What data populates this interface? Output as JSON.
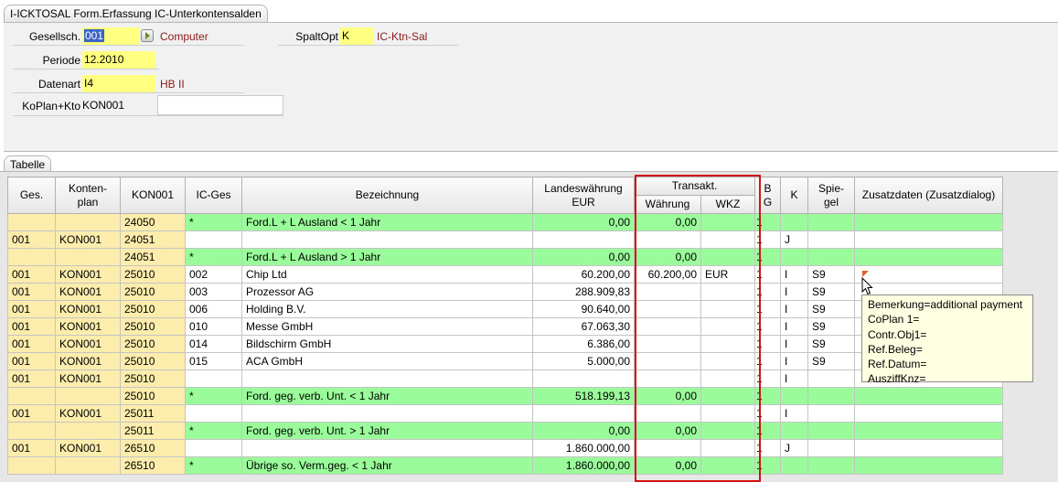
{
  "window": {
    "title": "I-ICKTOSAL Form.Erfassung IC-Unterkontensalden"
  },
  "form": {
    "gesellsch": {
      "label": "Gesellsch.",
      "value": "001",
      "desc": "Computer"
    },
    "periode": {
      "label": "Periode",
      "value": "12.2010"
    },
    "datenart": {
      "label": "Datenart",
      "value": "I4",
      "desc": "HB II"
    },
    "koplan": {
      "label": "KoPlan+Kto",
      "value": "KON001",
      "input_value": ""
    },
    "spaltopt": {
      "label": "SpaltOpt",
      "value": "K",
      "desc": "IC-Ktn-Sal"
    }
  },
  "table": {
    "tab_label": "Tabelle",
    "headers": {
      "ges": "Ges.",
      "konten_1": "Konten-",
      "konten_2": "plan",
      "kon": "KON001",
      "icges": "IC-Ges",
      "bez": "Bezeichnung",
      "lw_1": "Landeswährung",
      "lw_2": "EUR",
      "transakt": "Transakt.",
      "waehrung": "Währung",
      "wkz": "WKZ",
      "bg_1": "B",
      "bg_2": "G",
      "k": "K",
      "spiegel_1": "Spie-",
      "spiegel_2": "gel",
      "zusatz": "Zusatzdaten (Zusatzdialog)"
    },
    "rows": [
      {
        "type": "g",
        "ges": "",
        "plan": "",
        "kto": "24050",
        "icges": "*",
        "bez": "Ford.L + L Ausland < 1 Jahr",
        "lw": "0,00",
        "waehrung": "0,00",
        "wkz": "",
        "bg": "1",
        "k": "",
        "spiegel": "",
        "zusatz": ""
      },
      {
        "type": "w",
        "ges": "001",
        "plan": "KON001",
        "kto": "24051",
        "icges": "",
        "bez": "",
        "lw": "",
        "waehrung": "",
        "wkz": "",
        "bg": "1",
        "k": "J",
        "spiegel": "",
        "zusatz": ""
      },
      {
        "type": "g",
        "ges": "",
        "plan": "",
        "kto": "24051",
        "icges": "*",
        "bez": "Ford.L + L Ausland > 1 Jahr",
        "lw": "0,00",
        "waehrung": "0,00",
        "wkz": "",
        "bg": "1",
        "k": "",
        "spiegel": "",
        "zusatz": ""
      },
      {
        "type": "w",
        "ges": "001",
        "plan": "KON001",
        "kto": "25010",
        "icges": "002",
        "bez": "Chip Ltd",
        "lw": "60.200,00",
        "waehrung": "60.200,00",
        "wkz": "EUR",
        "bg": "1",
        "k": "I",
        "spiegel": "S9",
        "zusatz": ""
      },
      {
        "type": "w",
        "ges": "001",
        "plan": "KON001",
        "kto": "25010",
        "icges": "003",
        "bez": "Prozessor AG",
        "lw": "288.909,83",
        "waehrung": "",
        "wkz": "",
        "bg": "1",
        "k": "I",
        "spiegel": "S9",
        "zusatz": ""
      },
      {
        "type": "w",
        "ges": "001",
        "plan": "KON001",
        "kto": "25010",
        "icges": "006",
        "bez": "Holding B.V.",
        "lw": "90.640,00",
        "waehrung": "",
        "wkz": "",
        "bg": "1",
        "k": "I",
        "spiegel": "S9",
        "zusatz": ""
      },
      {
        "type": "w",
        "ges": "001",
        "plan": "KON001",
        "kto": "25010",
        "icges": "010",
        "bez": "Messe GmbH",
        "lw": "67.063,30",
        "waehrung": "",
        "wkz": "",
        "bg": "1",
        "k": "I",
        "spiegel": "S9",
        "zusatz": ""
      },
      {
        "type": "w",
        "ges": "001",
        "plan": "KON001",
        "kto": "25010",
        "icges": "014",
        "bez": "Bildschirm GmbH",
        "lw": "6.386,00",
        "waehrung": "",
        "wkz": "",
        "bg": "1",
        "k": "I",
        "spiegel": "S9",
        "zusatz": ""
      },
      {
        "type": "w",
        "ges": "001",
        "plan": "KON001",
        "kto": "25010",
        "icges": "015",
        "bez": "ACA GmbH",
        "lw": "5.000,00",
        "waehrung": "",
        "wkz": "",
        "bg": "1",
        "k": "I",
        "spiegel": "S9",
        "zusatz": ""
      },
      {
        "type": "w",
        "ges": "001",
        "plan": "KON001",
        "kto": "25010",
        "icges": "",
        "bez": "",
        "lw": "",
        "waehrung": "",
        "wkz": "",
        "bg": "1",
        "k": "I",
        "spiegel": "",
        "zusatz": ""
      },
      {
        "type": "g",
        "ges": "",
        "plan": "",
        "kto": "25010",
        "icges": "*",
        "bez": "Ford. geg. verb. Unt. < 1 Jahr",
        "lw": "518.199,13",
        "waehrung": "0,00",
        "wkz": "",
        "bg": "1",
        "k": "",
        "spiegel": "",
        "zusatz": ""
      },
      {
        "type": "w",
        "ges": "001",
        "plan": "KON001",
        "kto": "25011",
        "icges": "",
        "bez": "",
        "lw": "",
        "waehrung": "",
        "wkz": "",
        "bg": "1",
        "k": "I",
        "spiegel": "",
        "zusatz": ""
      },
      {
        "type": "g",
        "ges": "",
        "plan": "",
        "kto": "25011",
        "icges": "*",
        "bez": "Ford. geg. verb. Unt. > 1 Jahr",
        "lw": "0,00",
        "waehrung": "0,00",
        "wkz": "",
        "bg": "1",
        "k": "",
        "spiegel": "",
        "zusatz": ""
      },
      {
        "type": "w",
        "ges": "001",
        "plan": "KON001",
        "kto": "26510",
        "icges": "",
        "bez": "",
        "lw": "1.860.000,00",
        "waehrung": "",
        "wkz": "",
        "bg": "1",
        "k": "J",
        "spiegel": "",
        "zusatz": ""
      },
      {
        "type": "g",
        "ges": "",
        "plan": "",
        "kto": "26510",
        "icges": "*",
        "bez": "Übrige so. Verm.geg. < 1 Jahr",
        "lw": "1.860.000,00",
        "waehrung": "0,00",
        "wkz": "",
        "bg": "1",
        "k": "",
        "spiegel": "",
        "zusatz": ""
      }
    ]
  },
  "tooltip": {
    "lines": [
      "Bemerkung=additional payment",
      "CoPlan 1=",
      "Contr.Obj1=",
      "Ref.Beleg=",
      "Ref.Datum=",
      "AusziffKnz="
    ]
  },
  "colors": {
    "highlight_box": "#d01414",
    "sum_row": "#99fb99",
    "key_cell": "#fcedad",
    "input_required": "#ffff80",
    "description_text": "#8b1a1a"
  },
  "icons": [
    "lookup-arrow-icon",
    "note-marker-icon",
    "mouse-pointer-icon"
  ]
}
